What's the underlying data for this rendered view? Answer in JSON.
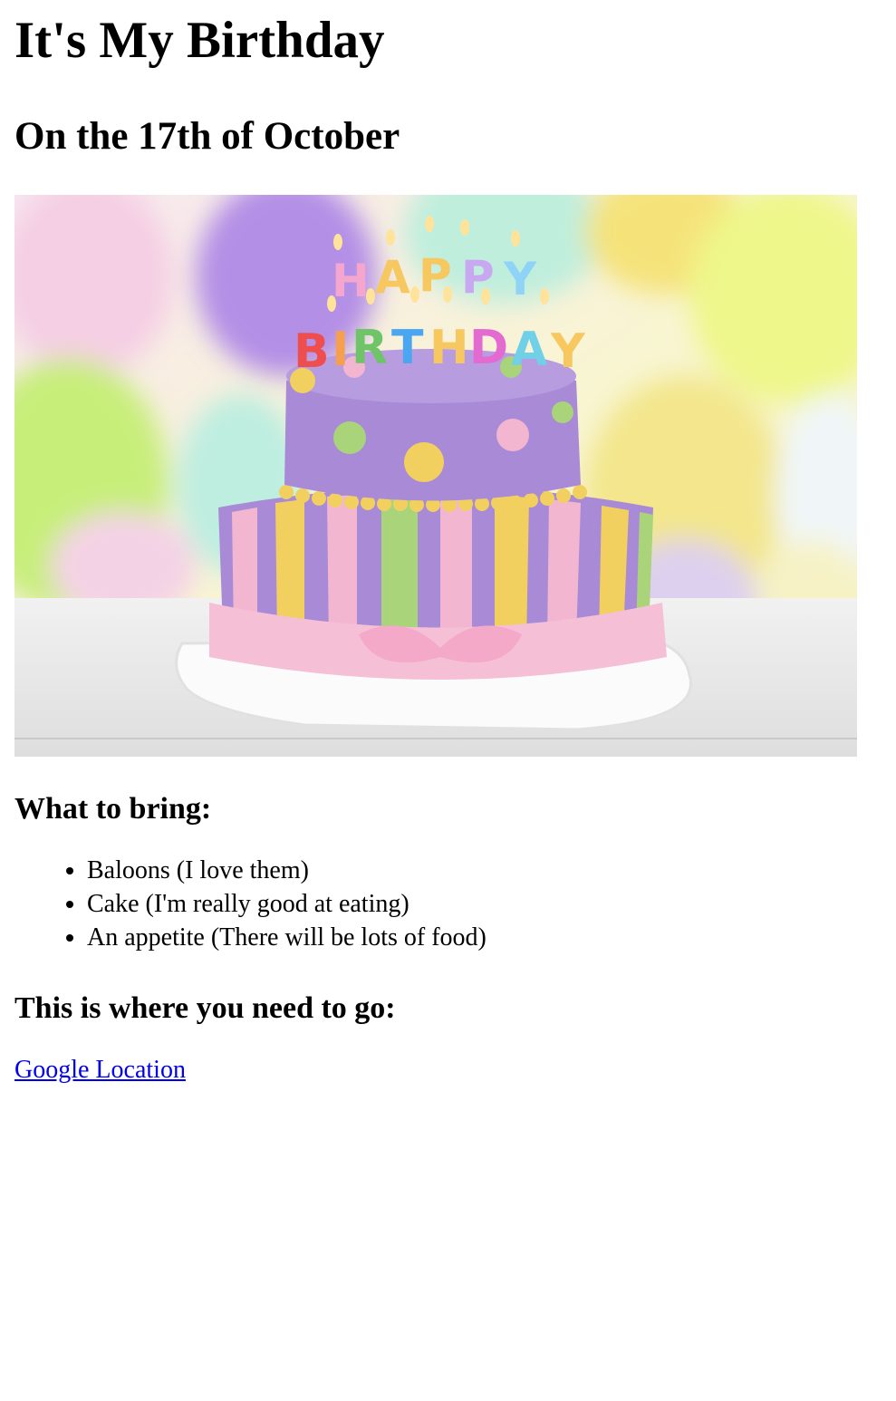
{
  "title": "It's My Birthday",
  "subtitle": "On the 17th of October",
  "hero_image": {
    "alt": "Birthday cake with happy birthday candles and balloons"
  },
  "bring": {
    "heading": "What to bring:",
    "items": [
      "Baloons (I love them)",
      "Cake (I'm really good at eating)",
      "An appetite (There will be lots of food)"
    ]
  },
  "location": {
    "heading": "This is where you need to go:",
    "link_label": "Google Location"
  },
  "colors": {
    "link": "#0000ee",
    "cake_purple": "#a98ad6",
    "cake_pink": "#f3b6d0",
    "cake_yellow": "#f2d060",
    "cake_green": "#a9d47a"
  }
}
